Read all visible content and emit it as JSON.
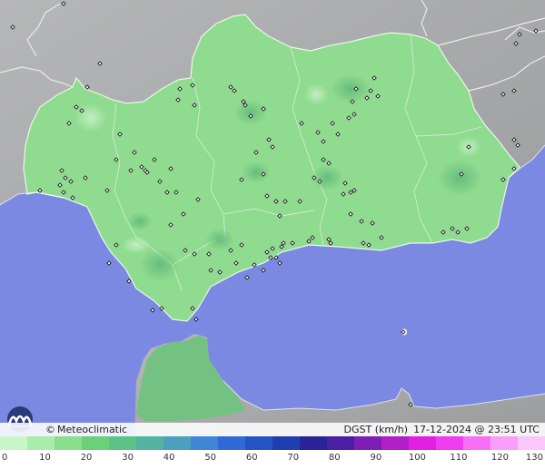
{
  "brand": {
    "copyright_symbol": "©",
    "name": "Meteoclimatic"
  },
  "header": {
    "variable": "DGST (km/h)",
    "datetime": "17-12-2024 @ 23:51 UTC"
  },
  "legend": {
    "ticks": [
      "0",
      "10",
      "20",
      "30",
      "40",
      "50",
      "60",
      "70",
      "80",
      "90",
      "100",
      "110",
      "120",
      "130"
    ],
    "colors": [
      "#c9f6c9",
      "#a9ecab",
      "#8ade8e",
      "#6ccf7a",
      "#5cc388",
      "#52b3a0",
      "#4aa0bd",
      "#3e86d6",
      "#2f6ad7",
      "#2553c6",
      "#1f3fb1",
      "#2a2398",
      "#4a1fa3",
      "#7d1fb5",
      "#b21fc8",
      "#e21fe2",
      "#f03cf0",
      "#f66ff6",
      "#f99ef9",
      "#fbc6fb"
    ],
    "range": [
      0,
      130
    ]
  },
  "map": {
    "colors": {
      "sea": "#7b89e2",
      "land_outside": "#a8a9aa",
      "region": "#8fdb8f",
      "region_dark": "#6fc57d",
      "station": "#1a1a1a"
    }
  }
}
